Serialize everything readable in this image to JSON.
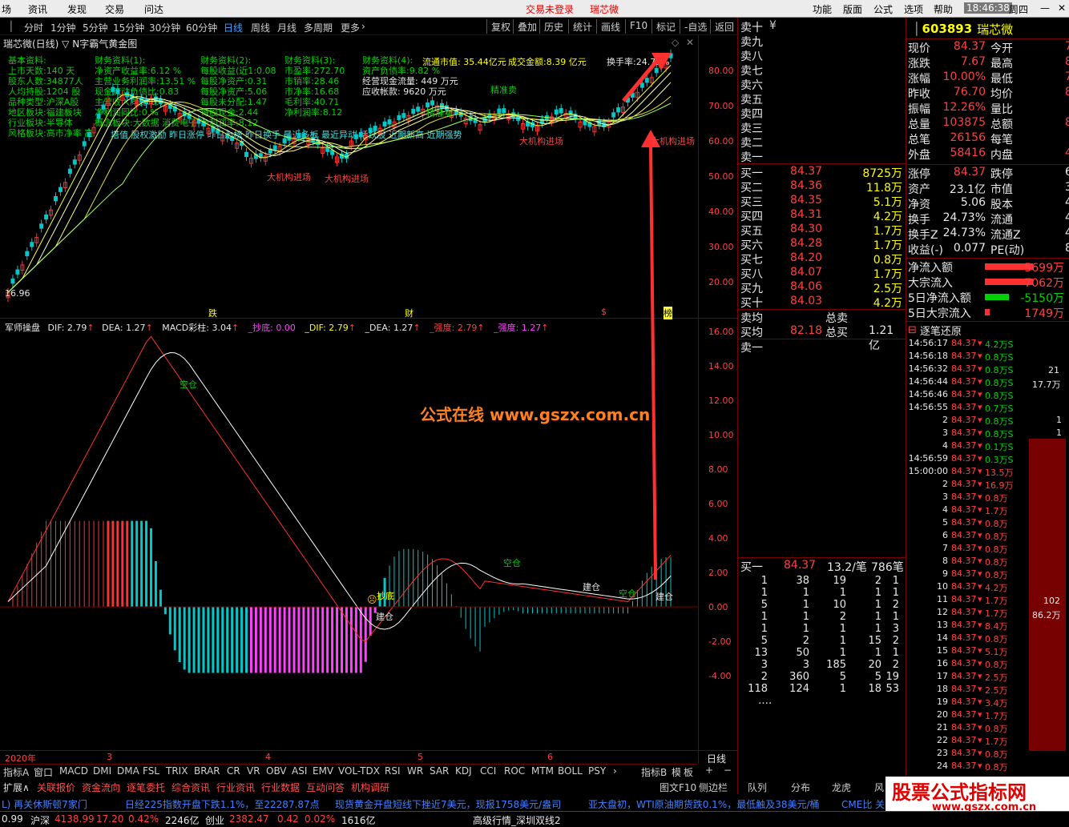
{
  "menu": {
    "left_items": [
      "场",
      "资讯",
      "发现",
      "交易",
      "问达"
    ],
    "trade_status": "交易未登录",
    "stock_name_title": "瑞芯微",
    "right_items": [
      "功能",
      "版面",
      "公式",
      "选项",
      "帮助"
    ],
    "time": "18:46:38",
    "weekday": "周四"
  },
  "timeframes": [
    "分时",
    "1分钟",
    "5分钟",
    "15分钟",
    "30分钟",
    "60分钟",
    "日线",
    "周线",
    "月线",
    "多周期",
    "更多"
  ],
  "active_timeframe": "日线",
  "toolbar": [
    "复权",
    "叠加",
    "历史",
    "统计",
    "画线",
    "F10",
    "标记",
    "-自选",
    "返回"
  ],
  "chart_title": "瑞芯微(日线) ▽ N字霸气黄金图",
  "info": {
    "col1": [
      "基本资料:",
      "上市天数:140  天",
      "股东人数:34877人",
      "人均持股:1204  股",
      "品种类型:沪深A股",
      "地区板块:福建板块",
      "行业板块:半导体",
      "风格板块:高市净率 高"
    ],
    "col2": [
      "财务资料(1):",
      "净资产收益率:6.12 %",
      "主营业务利润率:13.51 %",
      "现金流动负债比:0.83",
      "主营收入同比:0.%",
      "净利润同比:0.%",
      "概念板块:大数据 消费电子"
    ],
    "col3": [
      "财务资料(2):",
      "每股收益(近1:0.08",
      "每股净资产:0.31",
      "每股净资产:5.06",
      "每股未分配:1.47",
      "每股现金:2.44",
      "净利润率:8.12"
    ],
    "col4": [
      "财务资料(3):",
      "市盈率:272.70",
      "市销率:28.46",
      "市净率:16.68",
      "毛利率:40.71",
      "净利润率:8.12"
    ],
    "col5": [
      "财务资料(4):",
      "资产负债率:9.82 %",
      "经营现金流量: 449 万元",
      "应收帐款: 9620 万元"
    ],
    "market_cap": "流通市值: 35.44亿元",
    "turnover_amount": "成交金额:8.39 亿元",
    "turnover_rate": "换手率:24.73%",
    "style_line": "塔值 股权激励 昨日涨停 昨日上榜 昨日换手 最近多板 最近异动 活跃股 近期新高 近期强势"
  },
  "signals": {
    "sell": "精准卖",
    "sell2": "精准卖",
    "inst1": "大机构进场",
    "inst2": "大机构进场",
    "inst3": "大机构进场",
    "inst4": "大机构进场"
  },
  "price_axis": [
    "80.00",
    "70.00",
    "60.00",
    "50.00",
    "40.00",
    "30.00",
    "20.00"
  ],
  "price_low": "16.96",
  "markers": [
    "跌",
    "财",
    "$",
    "榜"
  ],
  "macd": {
    "name": "军师操盘",
    "dif": "DIF: 2.79",
    "dea": "DEA: 1.27",
    "bar": "MACD彩柱: 3.04",
    "bottom": "_抄底: 0.00",
    "dif2": "_DIF: 2.79",
    "dea2": "_DEA: 1.27",
    "strong": "_强度: 2.79",
    "strength": "_强度: 1.27"
  },
  "macd_axis": [
    "16.00",
    "14.00",
    "12.00",
    "10.00",
    "8.00",
    "6.00",
    "4.00",
    "2.00",
    "0.00",
    "-2.00",
    "-4.00"
  ],
  "macd_labels": {
    "zc1": "空仓",
    "zc2": "空仓",
    "zc3": "空仓",
    "cd": "抄底",
    "jc1": "建仓",
    "jc2": "建仓",
    "jc3": "建仓"
  },
  "watermark": "公式在线  www.gszx.com.cn",
  "x_labels": [
    "2020年",
    "3",
    "4",
    "5",
    "6"
  ],
  "period_label": "日线",
  "bottom_tabs": [
    "指标A",
    "窗口",
    "MACD",
    "DMI",
    "DMA",
    "FSL",
    "TRIX",
    "BRAR",
    "CR",
    "VR",
    "OBV",
    "ASI",
    "EMV",
    "VOL-TDX",
    "RSI",
    "WR",
    "SAR",
    "KDJ",
    "CCI",
    "ROC",
    "MTM",
    "BOLL",
    "PSY"
  ],
  "bottom_right": [
    "指标B",
    "模",
    "板"
  ],
  "bottom_tabs2": [
    "扩展∧",
    "关联报价",
    "资金流向",
    "逐笔委托",
    "综合资讯",
    "行业资讯",
    "行业数据",
    "互动问答",
    "机构调研"
  ],
  "right_tabs2": [
    "图文F10",
    "侧边栏",
    "队列",
    "分布",
    "龙虎",
    "风"
  ],
  "orderbook": {
    "sell": [
      "卖十",
      "卖九",
      "卖八",
      "卖七",
      "卖六",
      "卖五",
      "卖四",
      "卖三",
      "卖二",
      "卖一"
    ],
    "buy": [
      {
        "l": "买一",
        "p": "84.37",
        "v": "8725万"
      },
      {
        "l": "买二",
        "p": "84.36",
        "v": "11.8万"
      },
      {
        "l": "买三",
        "p": "84.35",
        "v": "5.1万"
      },
      {
        "l": "买四",
        "p": "84.31",
        "v": "4.2万"
      },
      {
        "l": "买五",
        "p": "84.30",
        "v": "1.7万"
      },
      {
        "l": "买六",
        "p": "84.28",
        "v": "1.7万"
      },
      {
        "l": "买七",
        "p": "84.20",
        "v": "0.8万"
      },
      {
        "l": "买八",
        "p": "84.07",
        "v": "1.7万"
      },
      {
        "l": "买九",
        "p": "84.06",
        "v": "2.5万"
      },
      {
        "l": "买十",
        "p": "84.03",
        "v": "4.2万"
      }
    ],
    "sell_avg": "卖均",
    "buy_avg": "买均",
    "buy_avg_val": "82.18",
    "total_sell": "总卖",
    "total_buy": "总买",
    "total_buy_val": "1.21亿",
    "sell1": "卖一",
    "queue_label": "买一",
    "queue_price": "84.37",
    "queue_per": "13.2/笔",
    "queue_count": "786笔",
    "queue": [
      [
        "1",
        "38",
        "19",
        "2",
        "1"
      ],
      [
        "1",
        "1",
        "1",
        "1",
        "1"
      ],
      [
        "5",
        "1",
        "10",
        "1",
        "2"
      ],
      [
        "1",
        "1",
        "2",
        "1",
        "1"
      ],
      [
        "1",
        "1",
        "1",
        "1",
        "3"
      ],
      [
        "5",
        "2",
        "1",
        "15",
        "2"
      ],
      [
        "13",
        "50",
        "1",
        "1",
        "1"
      ],
      [
        "3",
        "3",
        "185",
        "20",
        "2"
      ],
      [
        "2",
        "360",
        "5",
        "5",
        "19"
      ],
      [
        "118",
        "124",
        "1",
        "18",
        "53"
      ]
    ],
    "queue_more": "…."
  },
  "quote": {
    "code": "603893",
    "name": "瑞芯微",
    "rows": [
      [
        "现价",
        "84.37",
        "今开",
        "7"
      ],
      [
        "涨跌",
        "7.67",
        "最高",
        "8"
      ],
      [
        "涨幅",
        "10.00%",
        "最低",
        "7"
      ],
      [
        "昨收",
        "76.70",
        "均价",
        "8"
      ],
      [
        "振幅",
        "12.26%",
        "量比",
        ""
      ],
      [
        "总量",
        "103875",
        "总额",
        "8."
      ],
      [
        "总笔",
        "26156",
        "每笔",
        ""
      ],
      [
        "外盘",
        "58416",
        "内盘",
        "4"
      ]
    ],
    "rows2": [
      [
        "涨停",
        "84.37",
        "跌停",
        "6"
      ],
      [
        "资产",
        "23.1亿",
        "市值",
        "347"
      ],
      [
        "净资",
        "5.06",
        "股本",
        "4."
      ],
      [
        "换手",
        "24.73%",
        "流通",
        "42"
      ],
      [
        "换手Z",
        "24.73%",
        "流通Z",
        "42"
      ],
      [
        "收益(-)",
        "0.077",
        "PE(动)",
        "8"
      ]
    ],
    "flows": [
      [
        "净流入额",
        "5699万"
      ],
      [
        "大宗流入",
        "7062万"
      ],
      [
        "5日净流入额",
        "-5150万"
      ],
      [
        "5日大宗流入",
        "1749万"
      ]
    ]
  },
  "ticks_title": "逐笔还原",
  "ticks": [
    [
      "14:56:17",
      "84.37",
      "4.2万S"
    ],
    [
      "14:56:18",
      "84.37",
      "0.8万S"
    ],
    [
      "14:56:32",
      "84.37",
      "0.8万S"
    ],
    [
      "14:56:44",
      "84.37",
      "0.8万S"
    ],
    [
      "14:56:46",
      "84.37",
      "0.8万S"
    ],
    [
      "14:56:55",
      "84.37",
      "0.7万S"
    ],
    [
      "2",
      "84.37",
      "0.8万S"
    ],
    [
      "3",
      "84.37",
      "0.8万S"
    ],
    [
      "4",
      "84.37",
      "0.1万S"
    ],
    [
      "14:56:59",
      "84.37",
      "0.3万S"
    ],
    [
      "15:00:00",
      "84.37",
      "13.5万"
    ],
    [
      "2",
      "84.37",
      "16.9万"
    ],
    [
      "3",
      "84.37",
      "0.8万"
    ],
    [
      "4",
      "84.37",
      "1.7万"
    ],
    [
      "5",
      "84.37",
      "0.8万"
    ],
    [
      "6",
      "84.37",
      "0.8万"
    ],
    [
      "7",
      "84.37",
      "0.8万"
    ],
    [
      "8",
      "84.37",
      "0.8万"
    ],
    [
      "9",
      "84.37",
      "0.8万"
    ],
    [
      "10",
      "84.37",
      "4.2万"
    ],
    [
      "11",
      "84.37",
      "1.7万"
    ],
    [
      "12",
      "84.37",
      "1.7万"
    ],
    [
      "13",
      "84.37",
      "8.4万"
    ],
    [
      "14",
      "84.37",
      "0.8万"
    ],
    [
      "15",
      "84.37",
      "5.1万"
    ],
    [
      "16",
      "84.37",
      "0.8万"
    ],
    [
      "17",
      "84.37",
      "2.5万"
    ],
    [
      "18",
      "84.37",
      "2.5万"
    ],
    [
      "19",
      "84.37",
      "3.4万"
    ],
    [
      "20",
      "84.37",
      "1.7万"
    ],
    [
      "21",
      "84.37",
      "0.8万"
    ],
    [
      "22",
      "84.37",
      "1.7万"
    ],
    [
      "23",
      "84.37",
      "0.8万"
    ],
    [
      "24",
      "84.37",
      "0.8万"
    ]
  ],
  "tick_side": {
    "a": "21",
    "b": "17.7万",
    "c": "1",
    "d": "1",
    "e": "102",
    "f": "86.2万"
  },
  "news": [
    "L) 再关休斯顿7家门",
    "日经225指数开盘下跌1.1%，至22287.87点",
    "现货黄金开盘短线下挫近7美元，现报1758美元/盎司",
    "亚太盘初，WTI原油期货跌0.1%，最低触及38美元/桶",
    "CME比 关于"
  ],
  "status": {
    "sh": "沪深",
    "sh_val": "4138.99",
    "sh_chg": "17.20",
    "sh_pct": "0.42%",
    "sh_amt": "2246亿",
    "cy": "创业",
    "cy_val": "2382.47",
    "cy_chg": "0.42",
    "cy_pct": "0.02%",
    "cy_amt": "1616亿",
    "mode": "高级行情_深圳双线2",
    "lead": "0.99"
  },
  "brand": {
    "title": "股票公式指标网",
    "url": "www.gszx.com.cn"
  },
  "colors": {
    "up": "#ff3030",
    "down": "#00c8c8",
    "ma_yellow": "#ffff40",
    "bg": "#000000",
    "grid": "#700000"
  },
  "chart_data": {
    "type": "candlestick",
    "price_ylim": [
      16,
      86
    ],
    "macd_ylim": [
      -5,
      17
    ]
  }
}
